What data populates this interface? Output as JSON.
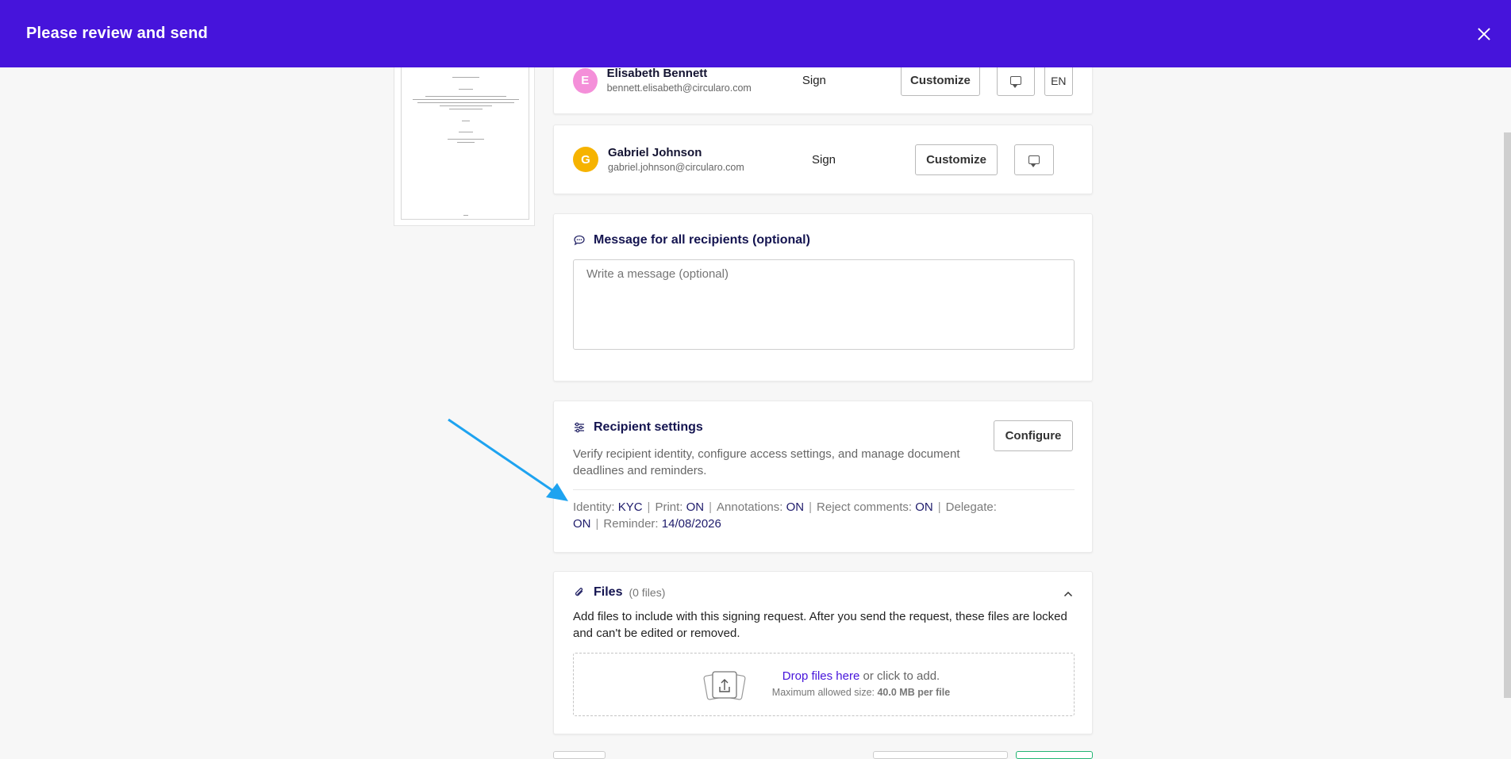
{
  "header": {
    "title": "Please review and send",
    "close_icon": "close-icon"
  },
  "recipients": [
    {
      "initial": "E",
      "name": "Elisabeth Bennett",
      "email": "bennett.elisabeth@circularo.com",
      "role": "Sign",
      "customize": "Customize",
      "lang": "EN",
      "avatar_color": "#f48fd9"
    },
    {
      "initial": "G",
      "name": "Gabriel Johnson",
      "email": "gabriel.johnson@circularo.com",
      "role": "Sign",
      "customize": "Customize",
      "avatar_color": "#f6b300"
    }
  ],
  "message": {
    "title": "Message for all recipients (optional)",
    "placeholder": "Write a message (optional)"
  },
  "settings": {
    "title": "Recipient settings",
    "description": "Verify recipient identity, configure access settings, and manage document deadlines and reminders.",
    "configure": "Configure",
    "identity_label": "Identity:",
    "identity_value": "KYC",
    "print_label": "Print:",
    "print_value": "ON",
    "annotations_label": "Annotations:",
    "annotations_value": "ON",
    "reject_label": "Reject comments:",
    "reject_value": "ON",
    "delegate_label": "Delegate:",
    "delegate_value": "ON",
    "reminder_label": "Reminder:",
    "reminder_value": "14/08/2026"
  },
  "files": {
    "title": "Files",
    "count": "(0 files)",
    "description": "Add files to include with this signing request. After you send the request, these files are locked and can't be edited or removed.",
    "drop_link": "Drop files here",
    "drop_rest": " or click to add.",
    "max_label": "Maximum allowed size: ",
    "max_value": "40.0 MB per file"
  },
  "colors": {
    "accent": "#4614db",
    "annotation_arrow": "#1ea3f0"
  }
}
